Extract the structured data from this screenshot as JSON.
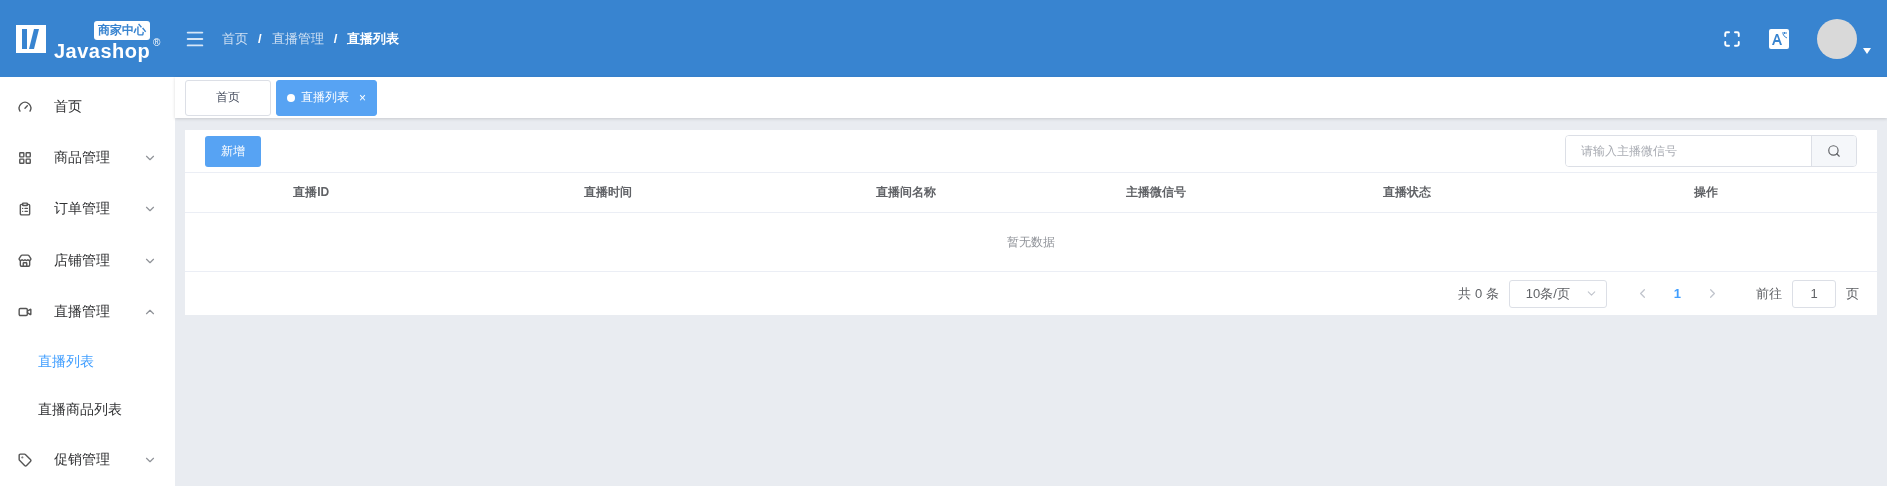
{
  "header": {
    "badge": "商家中心",
    "brand": "Javashop",
    "registered": "®",
    "breadcrumb": [
      "首页",
      "直播管理",
      "直播列表"
    ],
    "separator": "/"
  },
  "sidebar": {
    "items": [
      {
        "kind": "item",
        "label": "首页",
        "selected": false
      },
      {
        "kind": "group",
        "label": "商品管理",
        "expanded": false
      },
      {
        "kind": "group",
        "label": "订单管理",
        "expanded": false
      },
      {
        "kind": "group",
        "label": "店铺管理",
        "expanded": false
      },
      {
        "kind": "group",
        "label": "直播管理",
        "expanded": true,
        "children": [
          {
            "label": "直播列表",
            "selected": true
          },
          {
            "label": "直播商品列表",
            "selected": false
          }
        ]
      },
      {
        "kind": "group",
        "label": "促销管理",
        "expanded": false
      }
    ]
  },
  "tabs": [
    {
      "label": "首页",
      "selected": false
    },
    {
      "label": "直播列表",
      "selected": true,
      "close": "×"
    }
  ],
  "toolbar": {
    "add_button": "新增",
    "search": {
      "placeholder": "请输入主播微信号"
    }
  },
  "table": {
    "columns": [
      "直播ID",
      "直播时间",
      "直播间名称",
      "主播微信号",
      "直播状态",
      "操作"
    ],
    "empty_text": "暂无数据"
  },
  "pagination": {
    "total": "共 0 条",
    "page_size": "10条/页",
    "pages": [
      {
        "label": "1",
        "selected": true
      }
    ],
    "goto_label": "前往",
    "goto_value": "1",
    "goto_suffix": "页"
  }
}
